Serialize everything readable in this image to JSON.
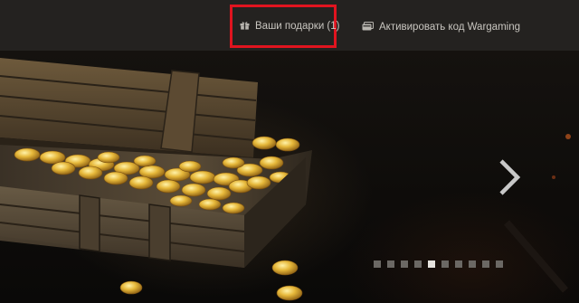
{
  "nav": {
    "gifts_label": "Ваши подарки (1)",
    "code_label": "Активировать код Wargaming",
    "gifts_icon": "gift-icon",
    "code_icon": "card-icon",
    "highlight_color": "#e0141f"
  },
  "banner": {
    "next_icon": "chevron-right-icon",
    "slides_total": 10,
    "active_slide": 5
  }
}
